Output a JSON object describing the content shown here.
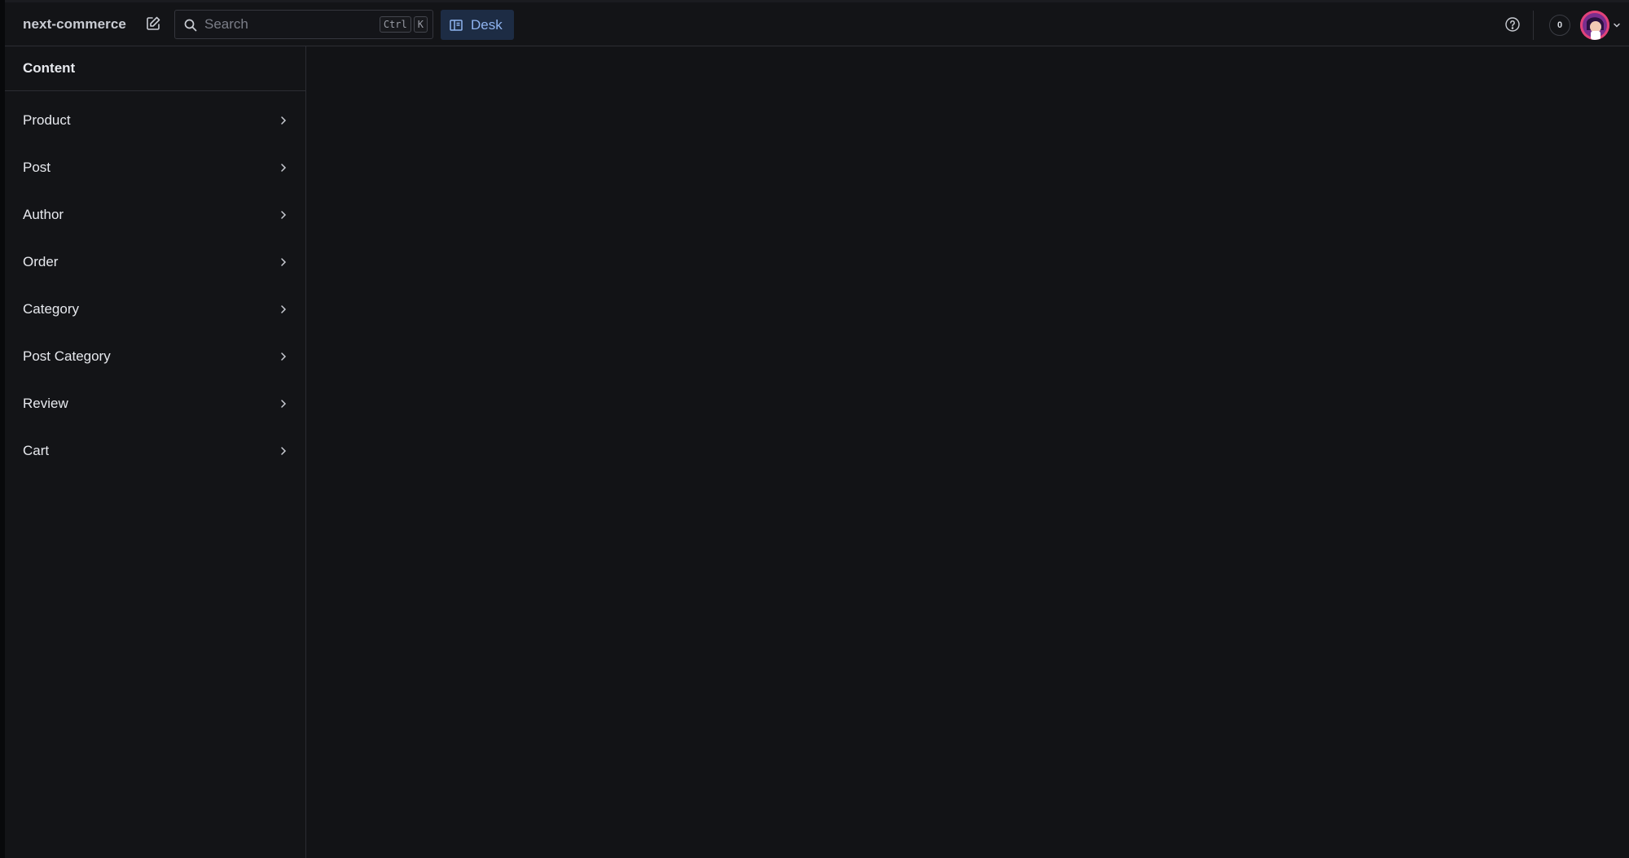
{
  "header": {
    "project_name": "next-commerce",
    "search": {
      "placeholder": "Search",
      "shortcut": [
        "Ctrl",
        "K"
      ]
    },
    "tool": {
      "label": "Desk",
      "icon": "layout-icon",
      "active": true
    },
    "notifications": {
      "count": "0"
    },
    "colors": {
      "accent": "#1d2c44",
      "accent_text": "#8fb4f0"
    }
  },
  "sidebar": {
    "title": "Content",
    "items": [
      {
        "label": "Product"
      },
      {
        "label": "Post"
      },
      {
        "label": "Author"
      },
      {
        "label": "Order"
      },
      {
        "label": "Category"
      },
      {
        "label": "Post Category"
      },
      {
        "label": "Review"
      },
      {
        "label": "Cart"
      }
    ]
  }
}
